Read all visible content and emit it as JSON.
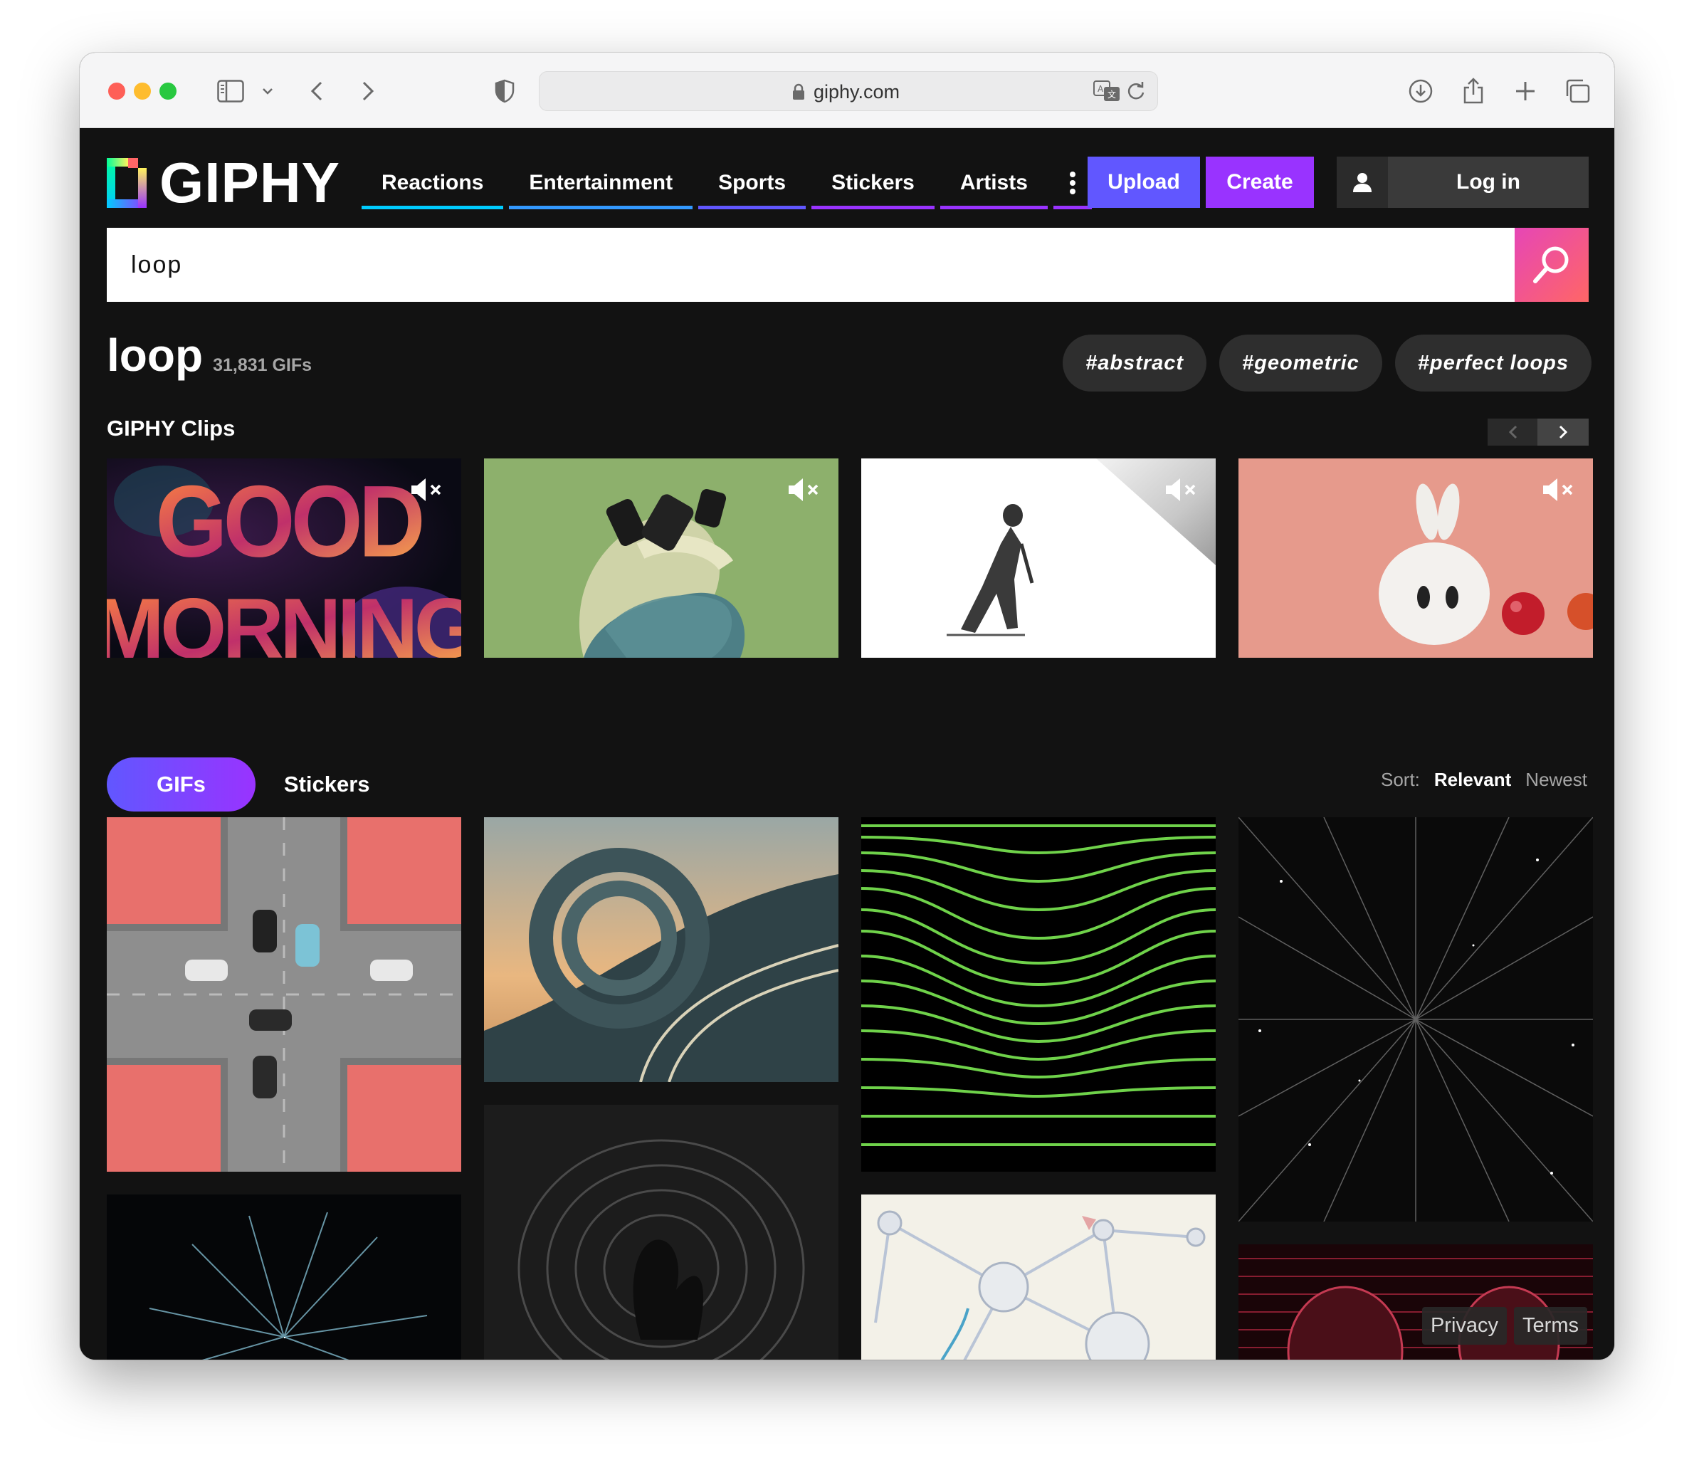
{
  "browser": {
    "url": "giphy.com"
  },
  "header": {
    "logo_text": "GIPHY",
    "nav": [
      {
        "label": "Reactions",
        "color": "#00ccff"
      },
      {
        "label": "Entertainment",
        "color": "#3399ff"
      },
      {
        "label": "Sports",
        "color": "#6157ff"
      },
      {
        "label": "Stickers",
        "color": "#9933ff"
      },
      {
        "label": "Artists",
        "color": "#9933ff"
      }
    ],
    "more_color": "#9933ff",
    "upload_label": "Upload",
    "create_label": "Create",
    "login_label": "Log in"
  },
  "search": {
    "value": "loop"
  },
  "results": {
    "title": "loop",
    "count": "31,831 GIFs",
    "tags": [
      "#abstract",
      "#geometric",
      "#perfect loops"
    ]
  },
  "clips": {
    "title": "GIPHY Clips",
    "items": [
      {
        "name": "good-morning-clip",
        "text_line1": "GOOD",
        "text_line2": "MORNING"
      },
      {
        "name": "pastel-twist-clip"
      },
      {
        "name": "sketch-figure-clip"
      },
      {
        "name": "bunny-clip"
      }
    ]
  },
  "tabs": {
    "gifs_label": "GIFs",
    "stickers_label": "Stickers"
  },
  "sort": {
    "label": "Sort:",
    "relevant": "Relevant",
    "newest": "Newest"
  },
  "footer": {
    "privacy": "Privacy",
    "terms": "Terms"
  }
}
